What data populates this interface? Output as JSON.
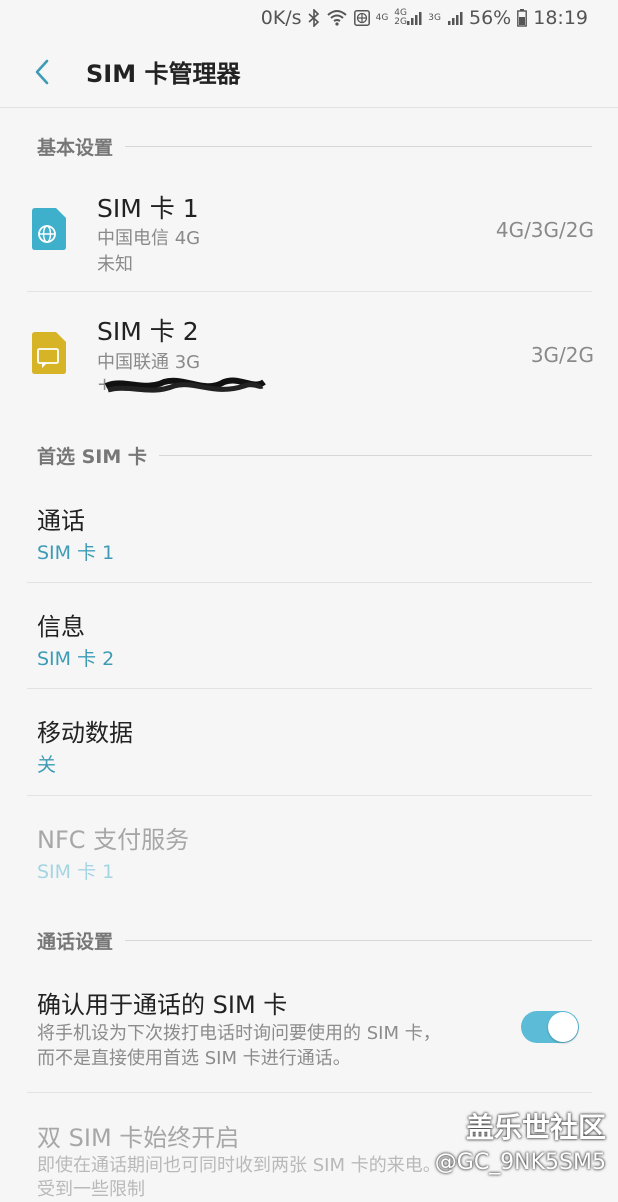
{
  "status_bar": {
    "speed": "0K/s",
    "net_4g": "4G",
    "net_4g2g": "4G 2G",
    "net_3g": "3G",
    "battery": "56%",
    "time": "18:19"
  },
  "app_bar": {
    "title": "SIM 卡管理器"
  },
  "basic_section": {
    "header": "基本设置",
    "sims": [
      {
        "name": "SIM 卡 1",
        "carrier": "中国电信 4G",
        "number": "未知",
        "network": "4G/3G/2G",
        "icon_color": "#3fb0cc"
      },
      {
        "name": "SIM 卡 2",
        "carrier": "中国联通 3G",
        "number": "+",
        "network": "3G/2G",
        "icon_color": "#d6b425"
      }
    ]
  },
  "preferred_section": {
    "header": "首选 SIM 卡",
    "items": [
      {
        "title": "通话",
        "value": "SIM 卡 1"
      },
      {
        "title": "信息",
        "value": "SIM 卡 2"
      },
      {
        "title": "移动数据",
        "value": "关"
      },
      {
        "title": "NFC 支付服务",
        "value": "SIM 卡 1"
      }
    ]
  },
  "call_section": {
    "header": "通话设置",
    "confirm_title": "确认用于通话的 SIM 卡",
    "confirm_desc_line1": "将手机设为下次拨打电话时询问要使用的 SIM 卡，",
    "confirm_desc_line2": "而不是直接使用首选 SIM 卡进行通话。",
    "confirm_enabled": true,
    "dual_title": "双 SIM 卡始终开启",
    "dual_desc_line1": "即使在通话期间也可同时收到两张 SIM 卡的来电。",
    "dual_desc_line2": "受到一些限制"
  },
  "watermark": {
    "line1": "盖乐世社区",
    "line2": "@GC_9NK5SM5"
  }
}
